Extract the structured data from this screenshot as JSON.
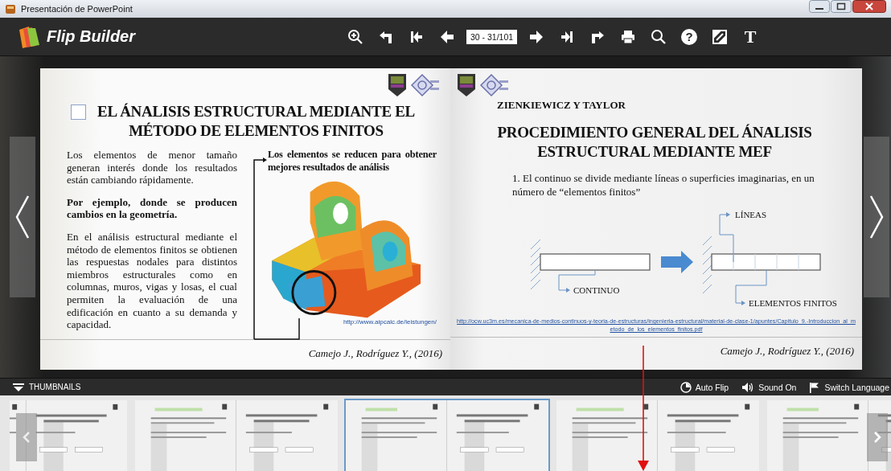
{
  "window": {
    "title": "Presentación de PowerPoint"
  },
  "toolbar": {
    "brand": "Flip Builder",
    "page_field": "30 - 31/101",
    "help_glyph": "?",
    "text_glyph": "T"
  },
  "left_page": {
    "title_lines": [
      "EL ÁNALISIS ESTRUCTURAL MEDIANTE EL",
      "MÉTODO DE ELEMENTOS FINITOS"
    ],
    "paragraphs": [
      {
        "text": "Los elementos de menor tamaño generan interés donde los resultados están cambiando rápidamente.",
        "bold": false
      },
      {
        "text": "Por ejemplo, donde se producen cambios en la geometría.",
        "bold": true
      },
      {
        "text": "En el análisis estructural mediante el método de elementos finitos se obtienen las respuestas nodales para distintos miembros estructurales como en columnas, muros, vigas y losas, el cual permiten la evaluación de una edificación en cuanto a su demanda y capacidad.",
        "bold": false
      }
    ],
    "caption": "Los elementos se reducen para obtener mejores resultados de análisis",
    "image": {
      "kind": "picture"
    },
    "source_link": "http://www.aipcalc.de/leistungen/",
    "footer": "Camejo J., Rodríguez Y., (2016)"
  },
  "right_page": {
    "header": "ZIENKIEWICZ Y TAYLOR",
    "title_lines": [
      "PROCEDIMIENTO GENERAL DEL ÁNALISIS",
      "ESTRUCTURAL MEDIANTE MEF"
    ],
    "text": "1. El continuo se divide mediante líneas o superficies imaginarias, en un número de “elementos finitos”",
    "diagram_labels": {
      "lines": "LÍNEAS",
      "continuum": "CONTINUO",
      "elements": "ELEMENTOS FINITOS"
    },
    "source_link": "http://ocw.uc3m.es/mecanica-de-medios-continuos-y-teoria-de-estructuras/ingenieria-estructural/material-de-clase-1/apuntes/Capitulo_9.-Introduccion_al_metodo_de_los_elementos_finitos.pdf",
    "footer": "Camejo J., Rodríguez Y., (2016)"
  },
  "thumbnails_bar": {
    "label": "THUMBNAILS",
    "expanded": true,
    "options": [
      {
        "kind": "autoflip",
        "label": "Auto Flip"
      },
      {
        "kind": "sound",
        "label": "Sound On"
      },
      {
        "kind": "language",
        "label": "Switch Language"
      }
    ]
  },
  "thumbnails": [
    {
      "selected": false
    },
    {
      "selected": false
    },
    {
      "selected": true
    },
    {
      "selected": false
    },
    {
      "selected": false
    }
  ]
}
